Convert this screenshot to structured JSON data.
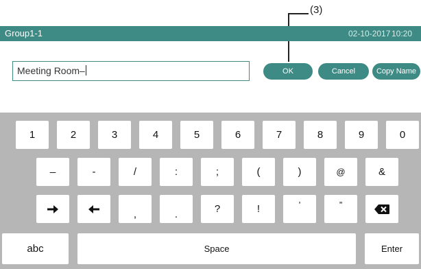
{
  "annotation": {
    "label": "(3)"
  },
  "titlebar": {
    "title": "Group1-1",
    "date": "02-10-2017",
    "time": "10:20"
  },
  "name_input": {
    "value": "Meeting Room–"
  },
  "buttons": {
    "ok": "OK",
    "cancel": "Cancel",
    "copy_name": "Copy Name"
  },
  "keyboard": {
    "row1": [
      "1",
      "2",
      "3",
      "4",
      "5",
      "6",
      "7",
      "8",
      "9",
      "0"
    ],
    "row2": [
      "_",
      "-",
      "/",
      ":",
      ";",
      "(",
      ")",
      "@",
      "&"
    ],
    "row3": [
      ",",
      ".",
      "?",
      "!",
      "’",
      "”"
    ],
    "abc": "abc",
    "space": "Space",
    "enter": "Enter",
    "icons": {
      "cursor_right": "arrow-right-icon",
      "cursor_left": "arrow-left-icon",
      "backspace": "backspace-icon"
    }
  },
  "colors": {
    "accent": "#3e8a84",
    "keyboard_bg": "#b6b6b6",
    "key_bg": "#ffffff",
    "dark_key": "#1a1a1a"
  }
}
